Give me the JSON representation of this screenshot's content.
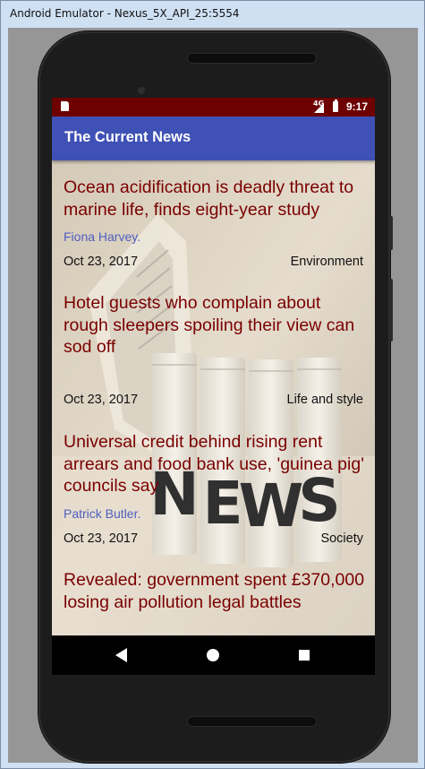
{
  "window": {
    "title": "Android Emulator - Nexus_5X_API_25:5554"
  },
  "status_bar": {
    "network": "4G",
    "time": "9:17"
  },
  "app_bar": {
    "title": "The Current News"
  },
  "background_art": {
    "letters": [
      "N",
      "E",
      "W",
      "S"
    ]
  },
  "articles": [
    {
      "headline": "Ocean acidification is deadly threat to marine life, finds eight-year study",
      "author": "Fiona Harvey.",
      "date": "Oct 23, 2017",
      "section": "Environment"
    },
    {
      "headline": "Hotel guests who complain about rough sleepers spoiling their view can sod off",
      "author": "",
      "date": "Oct 23, 2017",
      "section": "Life and style"
    },
    {
      "headline": "Universal credit behind rising rent arrears and food bank use, 'guinea pig' councils say",
      "author": "Patrick Butler.",
      "date": "Oct 23, 2017",
      "section": "Society"
    },
    {
      "headline": "Revealed: government spent £370,000 losing air pollution legal battles",
      "author": "",
      "date": "",
      "section": ""
    }
  ],
  "colors": {
    "status_bar": "#6d0000",
    "app_bar": "#3f51b5",
    "headline": "#7a0000",
    "author": "#5060c0"
  },
  "nav_icons": [
    "back-icon",
    "home-icon",
    "recents-icon"
  ]
}
